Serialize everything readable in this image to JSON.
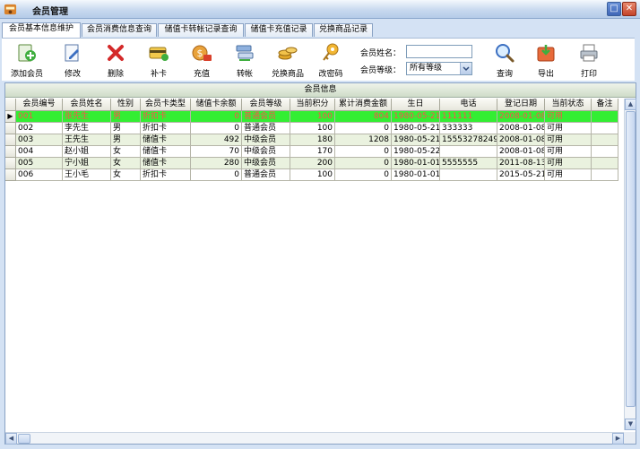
{
  "window": {
    "title": "会员管理"
  },
  "tabs": [
    {
      "label": "会员基本信息维护",
      "active": true
    },
    {
      "label": "会员消费信息查询",
      "active": false
    },
    {
      "label": "储值卡转帐记录查询",
      "active": false
    },
    {
      "label": "储值卡充值记录",
      "active": false
    },
    {
      "label": "兑换商品记录",
      "active": false
    }
  ],
  "toolbar": {
    "add": "添加会员",
    "edit": "修改",
    "delete": "删除",
    "reissue": "补卡",
    "recharge": "充值",
    "transfer": "转帐",
    "exchange": "兑换商品",
    "password": "改密码",
    "query": "查询",
    "export": "导出",
    "print": "打印"
  },
  "filters": {
    "name_label": "会员姓名：",
    "name_value": "",
    "level_label": "会员等级：",
    "level_value": "所有等级"
  },
  "grid": {
    "title": "会员信息",
    "columns": [
      "会员编号",
      "会员姓名",
      "性别",
      "会员卡类型",
      "储值卡余额",
      "会员等级",
      "当前积分",
      "累计消费金额",
      "生日",
      "电话",
      "登记日期",
      "当前状态",
      "备注"
    ],
    "rows": [
      [
        "001",
        "张先生",
        "男",
        "折扣卡",
        "0",
        "普通会员",
        "100",
        "804",
        "1980-05-21",
        "111111",
        "2008-01-08",
        "可用",
        ""
      ],
      [
        "002",
        "李先生",
        "男",
        "折扣卡",
        "0",
        "普通会员",
        "100",
        "0",
        "1980-05-21",
        "333333",
        "2008-01-08",
        "可用",
        ""
      ],
      [
        "003",
        "王先生",
        "男",
        "储值卡",
        "492",
        "中级会员",
        "180",
        "1208",
        "1980-05-21",
        "15553278249",
        "2008-01-08",
        "可用",
        ""
      ],
      [
        "004",
        "赵小姐",
        "女",
        "储值卡",
        "70",
        "中级会员",
        "170",
        "0",
        "1980-05-22",
        "",
        "2008-01-08",
        "可用",
        ""
      ],
      [
        "005",
        "宁小姐",
        "女",
        "储值卡",
        "280",
        "中级会员",
        "200",
        "0",
        "1980-01-01",
        "5555555",
        "2011-08-13",
        "可用",
        ""
      ],
      [
        "006",
        "王小毛",
        "女",
        "折扣卡",
        "0",
        "普通会员",
        "100",
        "0",
        "1980-01-01",
        "",
        "2015-05-21",
        "可用",
        ""
      ]
    ]
  },
  "colors": {
    "selected_row": "#33ee33",
    "selected_text": "#ff4d4d",
    "alt_row": "#eaf2df"
  }
}
